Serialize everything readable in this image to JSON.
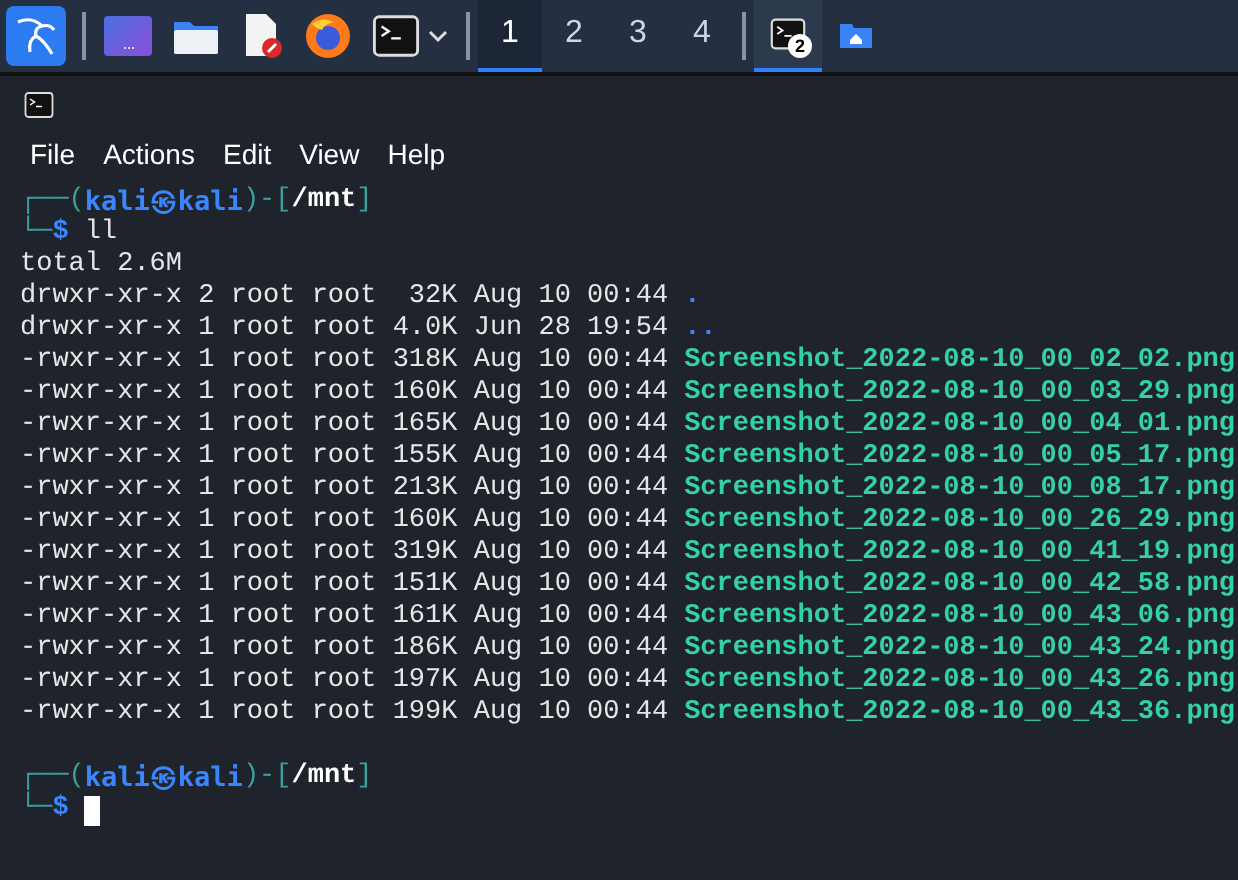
{
  "taskbar": {
    "launchers": [
      {
        "kind": "desktop"
      },
      {
        "kind": "folder"
      },
      {
        "kind": "editor"
      },
      {
        "kind": "browser"
      },
      {
        "kind": "terminal"
      }
    ],
    "workspaces": [
      {
        "label": "1",
        "selected": true
      },
      {
        "label": "2",
        "selected": false
      },
      {
        "label": "3",
        "selected": false
      },
      {
        "label": "4",
        "selected": false
      }
    ],
    "tasks": [
      {
        "kind": "terminal",
        "badge": "2",
        "selected": true
      },
      {
        "kind": "home-folder",
        "selected": false
      }
    ]
  },
  "menu": [
    "File",
    "Actions",
    "Edit",
    "View",
    "Help"
  ],
  "terminal": {
    "prompts": [
      {
        "frame_top": "┌──(",
        "user": "kali㉿kali",
        "sep": ")-[",
        "path": "/mnt",
        "close": "]",
        "frame_bottom": "└─",
        "symbol": "$",
        "command": "ll",
        "cursor": false
      },
      {
        "frame_top": "┌──(",
        "user": "kali㉿kali",
        "sep": ")-[",
        "path": "/mnt",
        "close": "]",
        "frame_bottom": "└─",
        "symbol": "$",
        "cursor": true
      }
    ],
    "total": "total 2.6M",
    "rows": [
      {
        "meta": "drwxr-xr-x 2 root root  32K Aug 10 00:44",
        "name": ".",
        "kind": "dir"
      },
      {
        "meta": "drwxr-xr-x 1 root root 4.0K Jun 28 19:54",
        "name": "..",
        "kind": "dir"
      },
      {
        "meta": "-rwxr-xr-x 1 root root 318K Aug 10 00:44",
        "name": "Screenshot_2022-08-10_00_02_02.png",
        "kind": "file"
      },
      {
        "meta": "-rwxr-xr-x 1 root root 160K Aug 10 00:44",
        "name": "Screenshot_2022-08-10_00_03_29.png",
        "kind": "file"
      },
      {
        "meta": "-rwxr-xr-x 1 root root 165K Aug 10 00:44",
        "name": "Screenshot_2022-08-10_00_04_01.png",
        "kind": "file"
      },
      {
        "meta": "-rwxr-xr-x 1 root root 155K Aug 10 00:44",
        "name": "Screenshot_2022-08-10_00_05_17.png",
        "kind": "file"
      },
      {
        "meta": "-rwxr-xr-x 1 root root 213K Aug 10 00:44",
        "name": "Screenshot_2022-08-10_00_08_17.png",
        "kind": "file"
      },
      {
        "meta": "-rwxr-xr-x 1 root root 160K Aug 10 00:44",
        "name": "Screenshot_2022-08-10_00_26_29.png",
        "kind": "file"
      },
      {
        "meta": "-rwxr-xr-x 1 root root 319K Aug 10 00:44",
        "name": "Screenshot_2022-08-10_00_41_19.png",
        "kind": "file"
      },
      {
        "meta": "-rwxr-xr-x 1 root root 151K Aug 10 00:44",
        "name": "Screenshot_2022-08-10_00_42_58.png",
        "kind": "file"
      },
      {
        "meta": "-rwxr-xr-x 1 root root 161K Aug 10 00:44",
        "name": "Screenshot_2022-08-10_00_43_06.png",
        "kind": "file"
      },
      {
        "meta": "-rwxr-xr-x 1 root root 186K Aug 10 00:44",
        "name": "Screenshot_2022-08-10_00_43_24.png",
        "kind": "file"
      },
      {
        "meta": "-rwxr-xr-x 1 root root 197K Aug 10 00:44",
        "name": "Screenshot_2022-08-10_00_43_26.png",
        "kind": "file"
      },
      {
        "meta": "-rwxr-xr-x 1 root root 199K Aug 10 00:44",
        "name": "Screenshot_2022-08-10_00_43_36.png",
        "kind": "file"
      }
    ]
  }
}
